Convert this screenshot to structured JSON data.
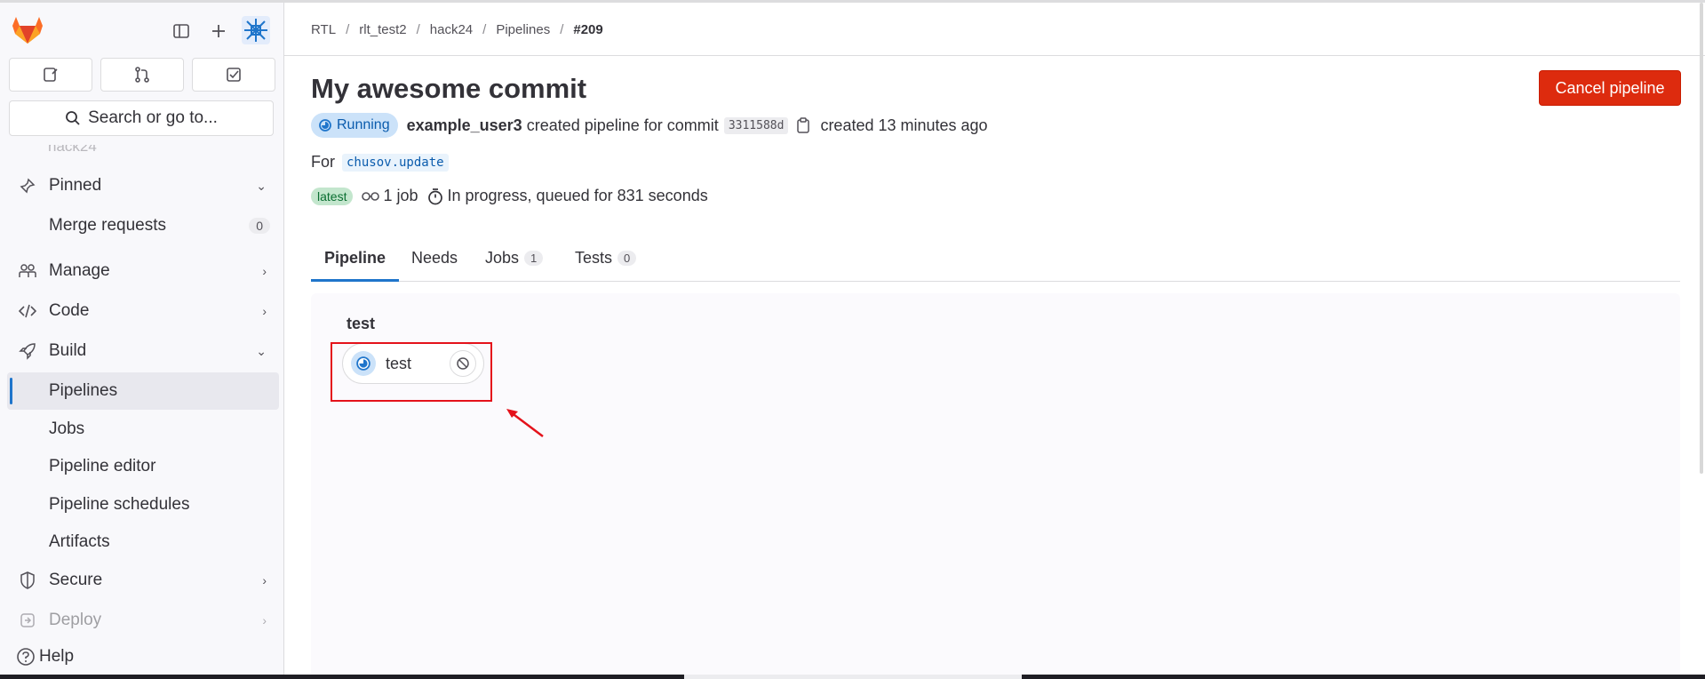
{
  "sidebar": {
    "search_placeholder": "Search or go to...",
    "cut_item_label": "hack24",
    "items": [
      {
        "label": "Pinned",
        "chevron": "down"
      },
      {
        "label": "Merge requests",
        "badge": "0"
      },
      {
        "label": "Manage",
        "chevron": "right"
      },
      {
        "label": "Code",
        "chevron": "right"
      },
      {
        "label": "Build",
        "chevron": "down"
      },
      {
        "label": "Pipelines"
      },
      {
        "label": "Jobs"
      },
      {
        "label": "Pipeline editor"
      },
      {
        "label": "Pipeline schedules"
      },
      {
        "label": "Artifacts"
      },
      {
        "label": "Secure",
        "chevron": "right"
      },
      {
        "label": "Deploy",
        "chevron": "right"
      }
    ],
    "help_label": "Help"
  },
  "breadcrumb": [
    "RTL",
    "rlt_test2",
    "hack24",
    "Pipelines",
    "#209"
  ],
  "pipeline": {
    "title": "My awesome commit",
    "cancel_label": "Cancel pipeline",
    "status": "Running",
    "user": "example_user3",
    "created_text": "created pipeline for commit",
    "sha": "3311588d",
    "created_ago": "created 13 minutes ago",
    "for_label": "For",
    "ref": "chusov.update",
    "latest_badge": "latest",
    "jobs_count": "1 job",
    "duration_text": "In progress, queued for 831 seconds"
  },
  "tabs": [
    {
      "label": "Pipeline"
    },
    {
      "label": "Needs"
    },
    {
      "label": "Jobs",
      "count": "1"
    },
    {
      "label": "Tests",
      "count": "0"
    }
  ],
  "graph": {
    "stage": "test",
    "job": "test"
  },
  "colors": {
    "accent": "#1f75cb",
    "danger": "#dd2b0e",
    "annotation": "#e4121b"
  }
}
